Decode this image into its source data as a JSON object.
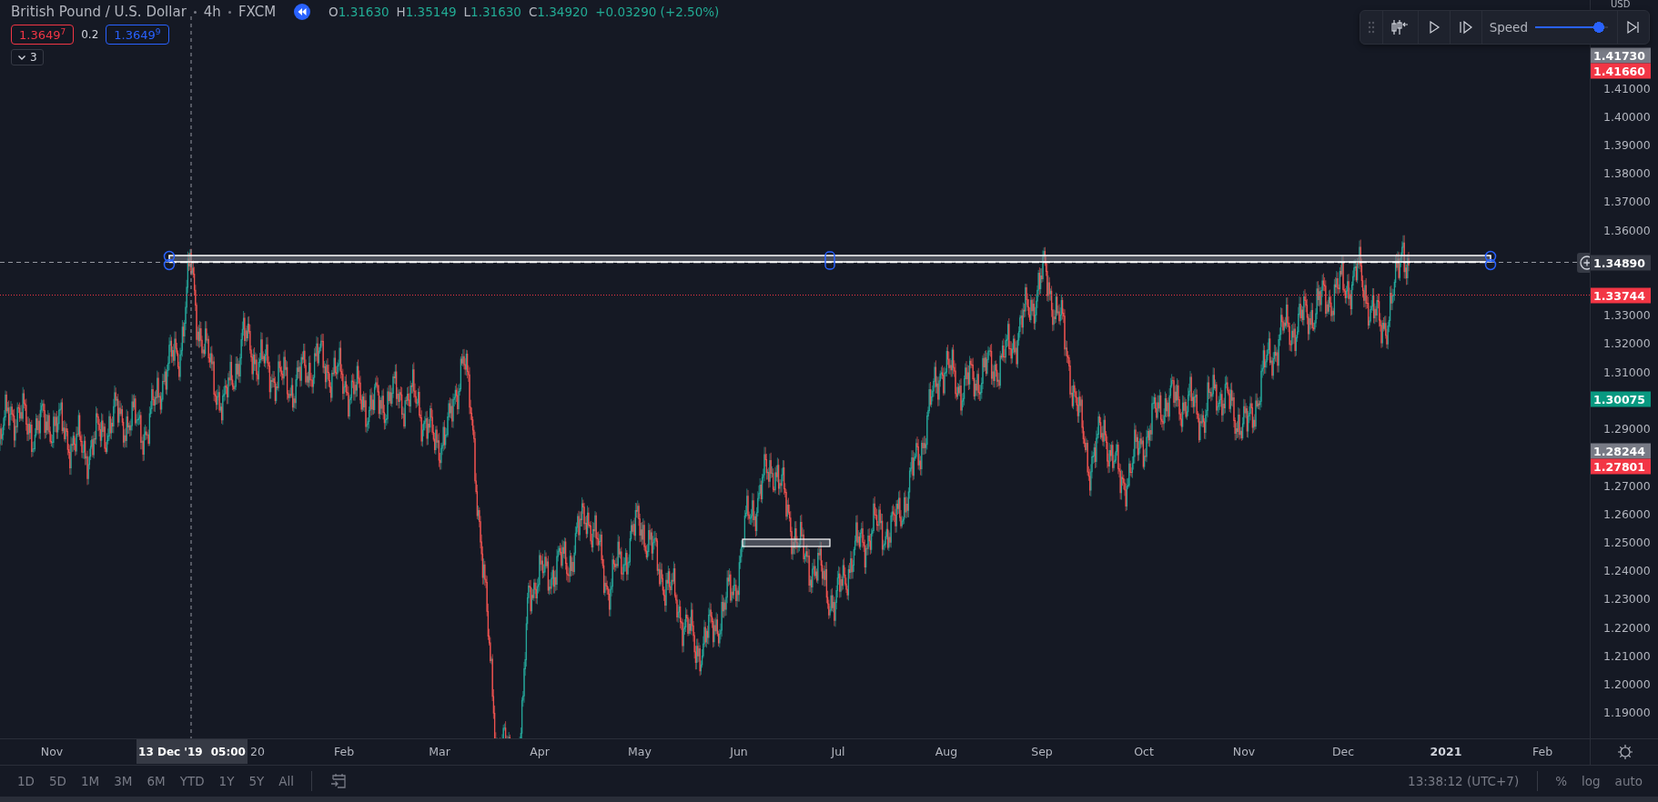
{
  "legend": {
    "symbol": "British Pound / U.S. Dollar",
    "interval": "4h",
    "exchange": "FXCM",
    "ohlc": [
      {
        "label": "O",
        "value": "1.31630"
      },
      {
        "label": "H",
        "value": "1.35149"
      },
      {
        "label": "L",
        "value": "1.31630"
      },
      {
        "label": "C",
        "value": "1.34920"
      }
    ],
    "change": "+0.03290 (+2.50%)",
    "sell_price": "1.3649$^{7}$",
    "spread": "0.2",
    "buy_price": "1.3649$^{9}$",
    "indicators_count": "3"
  },
  "replay": {
    "speed_label": "Speed",
    "speed": {
      "level": 1.0
    }
  },
  "price_axis": {
    "currency": "USD",
    "ticks": [
      "1.41000",
      "1.40000",
      "1.39000",
      "1.38000",
      "1.37000",
      "1.36000",
      "1.33000",
      "1.32000",
      "1.31000",
      "1.29000",
      "1.27000",
      "1.26000",
      "1.25000",
      "1.24000",
      "1.23000",
      "1.22000",
      "1.21000",
      "1.20000",
      "1.19000"
    ],
    "badges": [
      {
        "value": "1.41730",
        "color": "#787b86"
      },
      {
        "value": "1.41660",
        "color": "#f23645"
      },
      {
        "value": "1.34890",
        "color": "#363a45"
      },
      {
        "value": "1.33744",
        "color": "#f23645"
      },
      {
        "value": "1.30075",
        "color": "#089981"
      },
      {
        "value": "1.28244",
        "color": "#787b86"
      },
      {
        "value": "1.27801",
        "color": "#f23645"
      }
    ]
  },
  "time_axis": {
    "labels": [
      {
        "text": "Nov",
        "bold": false
      },
      {
        "text": "20",
        "bold": false
      },
      {
        "text": "Feb",
        "bold": false
      },
      {
        "text": "Mar",
        "bold": false
      },
      {
        "text": "Apr",
        "bold": false
      },
      {
        "text": "May",
        "bold": false
      },
      {
        "text": "Jun",
        "bold": false
      },
      {
        "text": "Jul",
        "bold": false
      },
      {
        "text": "Aug",
        "bold": false
      },
      {
        "text": "Sep",
        "bold": false
      },
      {
        "text": "Oct",
        "bold": false
      },
      {
        "text": "Nov",
        "bold": false
      },
      {
        "text": "Dec",
        "bold": false
      },
      {
        "text": "2021",
        "bold": true
      },
      {
        "text": "Feb",
        "bold": false
      }
    ],
    "crosshair_label": {
      "date": "13 Dec '19",
      "time": "05:00"
    }
  },
  "bottom_bar": {
    "ranges": [
      "1D",
      "5D",
      "1M",
      "3M",
      "6M",
      "YTD",
      "1Y",
      "5Y",
      "All"
    ],
    "clock": "13:38:12 (UTC+7)",
    "toggles": [
      "%",
      "log",
      "auto"
    ]
  }
}
